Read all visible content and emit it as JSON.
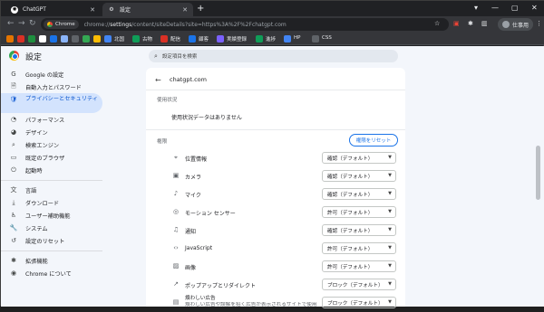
{
  "tabs": [
    {
      "title": "ChatGPT",
      "active": false
    },
    {
      "title": "設定",
      "active": true
    }
  ],
  "omnibox": {
    "chip_label": "Chrome",
    "url_prefix": "chrome://",
    "url_bold": "settings",
    "url_rest": "/content/siteDetails?site=https%3A%2F%2Fchatgpt.com"
  },
  "profile_label": "仕事用",
  "bookmarks": [
    {
      "label": "",
      "color": "#e37400"
    },
    {
      "label": "",
      "color": "#d93025"
    },
    {
      "label": "",
      "color": "#1e8e3e"
    },
    {
      "label": "",
      "color": "#ffffff"
    },
    {
      "label": "",
      "color": "#1a73e8"
    },
    {
      "label": "",
      "color": "#8ab4f8"
    },
    {
      "label": "",
      "color": "#5f6368"
    },
    {
      "label": "",
      "color": "#34a853"
    },
    {
      "label": "",
      "color": "#fbbc04"
    },
    {
      "label": "北国",
      "color": "#4285f4"
    },
    {
      "label": "古物",
      "color": "#0f9d58"
    },
    {
      "label": "配信",
      "color": "#d93025"
    },
    {
      "label": "顧客",
      "color": "#1a73e8"
    },
    {
      "label": "実績登録",
      "color": "#7b61ff"
    },
    {
      "label": "進捗",
      "color": "#0f9d58"
    },
    {
      "label": "HP",
      "color": "#4285f4"
    },
    {
      "label": "CSS",
      "color": "#5f6368"
    }
  ],
  "header": {
    "title": "設定",
    "search_placeholder": "設定項目を検索"
  },
  "sidebar": {
    "items": [
      {
        "label": "Google の設定",
        "icon": "G"
      },
      {
        "label": "自動入力とパスワード",
        "icon": "🗎"
      },
      {
        "label": "プライバシーとセキュリティ",
        "icon": "🛡"
      },
      {
        "label": "パフォーマンス",
        "icon": "◔"
      },
      {
        "label": "デザイン",
        "icon": "◕"
      },
      {
        "label": "検索エンジン",
        "icon": "⌕"
      },
      {
        "label": "既定のブラウザ",
        "icon": "▭"
      },
      {
        "label": "起動時",
        "icon": "⏻"
      },
      {
        "label": "言語",
        "icon": "文"
      },
      {
        "label": "ダウンロード",
        "icon": "⤓"
      },
      {
        "label": "ユーザー補助機能",
        "icon": "♿"
      },
      {
        "label": "システム",
        "icon": "🔧"
      },
      {
        "label": "設定のリセット",
        "icon": "↺"
      },
      {
        "label": "拡張機能",
        "icon": "✱"
      },
      {
        "label": "Chrome について",
        "icon": "◉"
      }
    ]
  },
  "site": {
    "name": "chatgpt.com",
    "usage_heading": "使用状況",
    "usage_text": "使用状況データはありません",
    "permissions_heading": "権限",
    "reset_label": "権限をリセット",
    "permissions": [
      {
        "label": "位置情報",
        "value": "確認（デフォルト）",
        "icon": "⌖"
      },
      {
        "label": "カメラ",
        "value": "確認（デフォルト）",
        "icon": "▣"
      },
      {
        "label": "マイク",
        "value": "確認（デフォルト）",
        "icon": "♪"
      },
      {
        "label": "モーション センサー",
        "value": "許可（デフォルト）",
        "icon": "◎"
      },
      {
        "label": "通知",
        "value": "確認（デフォルト）",
        "icon": "♫"
      },
      {
        "label": "JavaScript",
        "value": "許可（デフォルト）",
        "icon": "‹›"
      },
      {
        "label": "画像",
        "value": "許可（デフォルト）",
        "icon": "▨"
      },
      {
        "label": "ポップアップとリダイレクト",
        "value": "ブロック（デフォルト）",
        "icon": "↗"
      },
      {
        "label": "煩わしい広告",
        "sublabel": "煩わしい広告や誤解を招く広告が表示されるサイトで使用",
        "value": "ブロック（デフォルト）",
        "icon": "▤"
      }
    ]
  }
}
